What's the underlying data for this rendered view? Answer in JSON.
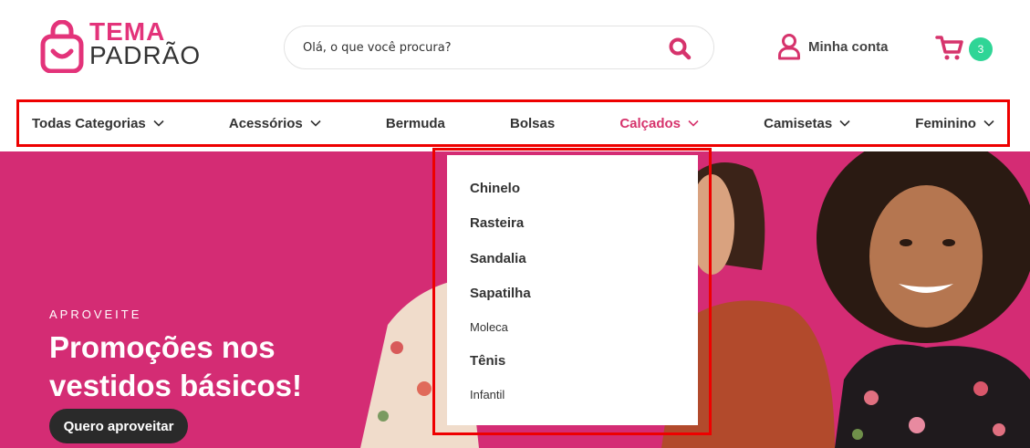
{
  "header": {
    "logo": {
      "line1": "TEMA",
      "line2": "PADRÃO",
      "brand_color": "#e3337a"
    },
    "search": {
      "placeholder": "Olá, o que você procura?",
      "icon": "search-icon"
    },
    "account": {
      "label": "Minha conta",
      "icon": "user-icon"
    },
    "cart": {
      "count": "3",
      "icon": "cart-icon",
      "badge_color": "#2fd596"
    }
  },
  "nav": {
    "items": [
      {
        "label": "Todas Categorias",
        "has_dropdown": true
      },
      {
        "label": "Acessórios",
        "has_dropdown": true
      },
      {
        "label": "Bermuda",
        "has_dropdown": false
      },
      {
        "label": "Bolsas",
        "has_dropdown": false
      },
      {
        "label": "Calçados",
        "has_dropdown": true,
        "active": true
      },
      {
        "label": "Camisetas",
        "has_dropdown": true
      },
      {
        "label": "Feminino",
        "has_dropdown": true
      }
    ],
    "active_color": "#d6336c"
  },
  "dropdown": {
    "items": [
      {
        "label": "Chinelo",
        "style": "bold"
      },
      {
        "label": "Rasteira",
        "style": "bold"
      },
      {
        "label": "Sandalia",
        "style": "bold"
      },
      {
        "label": "Sapatilha",
        "style": "bold"
      },
      {
        "label": "Moleca",
        "style": "light"
      },
      {
        "label": "Tênis",
        "style": "bold"
      },
      {
        "label": "Infantil",
        "style": "light"
      }
    ]
  },
  "banner": {
    "eyebrow": "APROVEITE",
    "headline": "Promoções nos vestidos básicos!",
    "cta": "Quero aproveitar",
    "background_color": "#d42c74"
  }
}
